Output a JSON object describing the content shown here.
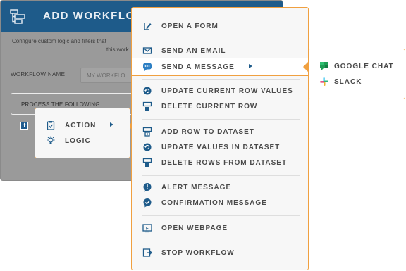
{
  "dialog": {
    "title": "ADD WORKFLO",
    "description_line1": "Configure custom logic and filters that",
    "description_line2": "this work",
    "workflow_name_label": "WORKFLOW NAME",
    "workflow_name_placeholder": "MY WORKFLO",
    "process_label": "PROCESS THE FOLLOWING",
    "add_icon": "plus-icon"
  },
  "small_menu": {
    "items": [
      {
        "label": "ACTION",
        "icon": "clipboard-check-icon"
      },
      {
        "label": "LOGIC",
        "icon": "lightbulb-icon"
      }
    ]
  },
  "main_menu": {
    "items": [
      {
        "label": "OPEN A FORM",
        "icon": "form-edit-icon"
      },
      {
        "label": "SEND AN EMAIL",
        "icon": "email-icon"
      },
      {
        "label": "SEND A MESSAGE",
        "icon": "chat-bubble-icon"
      },
      {
        "label": "UPDATE CURRENT ROW VALUES",
        "icon": "refresh-database-icon"
      },
      {
        "label": "DELETE CURRENT ROW",
        "icon": "delete-row-icon"
      },
      {
        "label": "ADD ROW TO DATASET",
        "icon": "add-row-icon"
      },
      {
        "label": "UPDATE VALUES IN DATASET",
        "icon": "refresh-database-icon"
      },
      {
        "label": "DELETE ROWS FROM DATASET",
        "icon": "delete-rows-icon"
      },
      {
        "label": "ALERT MESSAGE",
        "icon": "alert-icon"
      },
      {
        "label": "CONFIRMATION MESSAGE",
        "icon": "confirm-icon"
      },
      {
        "label": "OPEN WEBPAGE",
        "icon": "webpage-icon"
      },
      {
        "label": "STOP WORKFLOW",
        "icon": "stop-icon"
      }
    ]
  },
  "sub_menu": {
    "items": [
      {
        "label": "GOOGLE CHAT",
        "icon": "google-chat-icon"
      },
      {
        "label": "SLACK",
        "icon": "slack-icon"
      }
    ]
  },
  "colors": {
    "accent_orange": "#f0a040",
    "brand_blue": "#1e5b8a",
    "text_gray": "#4a4a4a"
  }
}
